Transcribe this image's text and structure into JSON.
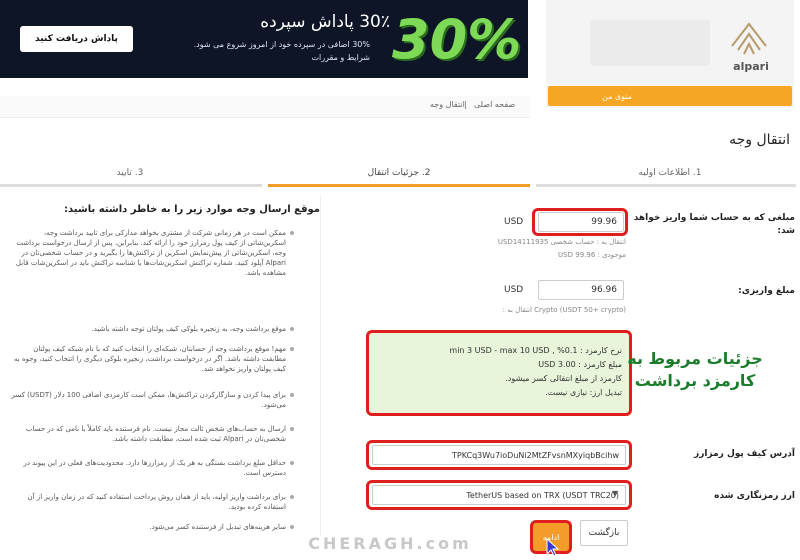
{
  "banner": {
    "button_label": "پاداش دریافت کنید",
    "title": "30٪ پاداش سپرده",
    "subtitle_line1": "30% اضافی در سپرده خود از امروز شروع می شود.",
    "subtitle_line2": "شرایط و مقررات",
    "big_text": "30%"
  },
  "brand": {
    "name": "alpari",
    "orange_bar_label": "منوی من"
  },
  "breadcrumb": {
    "home": "صفحه اصلی",
    "separator": "|",
    "current": "انتقال وجه"
  },
  "page_title": "انتقال وجه",
  "tabs": [
    {
      "label": "1. اطلاعات اولیه",
      "active": false
    },
    {
      "label": "2. جزئیات انتقال",
      "active": true
    },
    {
      "label": "3. تایید",
      "active": false
    }
  ],
  "form": {
    "amount_label": "مبلغی که به حساب شما واریز خواهد شد:",
    "amount_value": "99.96",
    "amount_currency": "USD",
    "account_line": "انتقال به : حساب شخصی USD14111935",
    "balance_line": "موجودی : 99.96 USD",
    "deposit_label": "مبلغ واریزی:",
    "deposit_value": "96.96",
    "deposit_currency": "USD",
    "deposit_hint": "Crypto (USDT 50+ crypto)  انتقال به :",
    "fee_lines": [
      "نرخ کارمزد : 0.1% , min 3 USD - max 10 USD",
      "مبلغ کارمزد : 3.00 USD",
      "کارمزد از مبلغ انتقالی کسر میشود.",
      "تبدیل ارز: نیازی نیست."
    ],
    "wallet_label": "آدرس کیف پول رمزارز",
    "wallet_value": "TPKCq3Wu7ioDuNi2MtZFvsnMXyiqbBcihw",
    "currency_label": "ارز رمزنگاری شده",
    "currency_value": "TetherUS based on TRX (USDT TRC20)",
    "currency_arrow": "▼",
    "next_label": "ادامه",
    "back_label": "بازگشت"
  },
  "annotation": "جزئیات مربوط به کارمزد برداشت",
  "guide": {
    "title": "موقع ارسال وجه موارد زیر را به خاطر داشته باشید:",
    "items": [
      "ممکن است در هر زمانی شرکت از مشتری بخواهد مدارکی برای تایید برداشت وجه، اسکرین‌شاتی از کیف پول رمزارز خود را ارائه کند. بنابراین، پس از ارسال درخواست برداشت وجه، اسکرین‌شاتی از پیش‌نمایش اسکرین از تراکنش‌ها را بگیرید و در حساب شخصی‌تان در Alpari آپلود کنید. شماره تراکنش اسکرین‌شات‌ها یا شناسه تراکنش باید در اسکرین‌شات قابل مشاهده باشد.",
      "موقع برداشت وجه، به زنجیره بلوکی کیف پولتان توجه داشته باشید.",
      "مهم! موقع برداشت وجه از حسابتان، شبکه‌ای را انتخاب کنید که با نام شبکه کیف پولتان مطابقت داشته باشد. اگر در درخواست برداشت، زنجیره بلوکی دیگری را انتخاب کنید، وجوه به کیف پولتان واریز نخواهد شد.",
      "برای پیدا کردن و سازگارکردن تراکنش‌ها، ممکن است کارمزدی اضافی 100 دلار (USDT) کسر می‌شود.",
      "ارسال به حساب‌های شخص ثالث مجاز نیست. نام فرستنده باید کاملاً با نامی که در حساب شخصی‌تان در Alpari ثبت شده است، مطابقت داشته باشد.",
      "حداقل مبلغ برداشت بستگی به هر یک از رمزارزها دارد. محدودیت‌های فعلی در این پیوند در دسترس است.",
      "برای برداشت واریز اولیه، باید از همان روش پرداخت استفاده کنید که در زمان واریز از آن استفاده کرده بودید.",
      "سایر هزینه‌های تبدیل از فرستنده کسر می‌شود."
    ]
  },
  "watermark": "CHERAGH.com"
}
